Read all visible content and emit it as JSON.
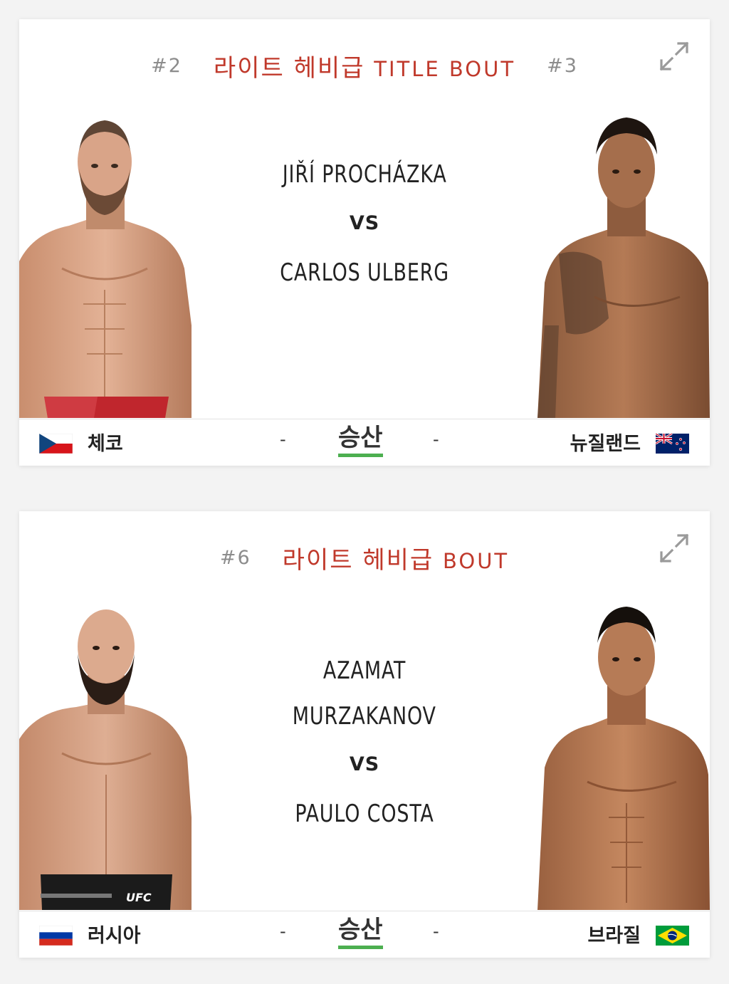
{
  "colors": {
    "title_red": "#c0392b",
    "rank_gray": "#8c8c8c",
    "result_underline": "#4caf50"
  },
  "bouts": [
    {
      "rank_left": "#2",
      "title_kr": "라이트 헤비급",
      "title_en": "TITLE BOUT",
      "rank_right": "#3",
      "fighter_red": "JIŘÍ PROCHÁZKA",
      "vs": "VS",
      "fighter_blue": "CARLOS ULBERG",
      "country_left": "체코",
      "country_right": "뉴질랜드",
      "flag_left": "czech-flag",
      "flag_right": "new-zealand-flag",
      "dash_left": "-",
      "dash_right": "-",
      "result": "승산",
      "expand_icon": "expand-icon"
    },
    {
      "rank_left": "#6",
      "title_kr": "라이트 헤비급",
      "title_en": "BOUT",
      "rank_right": "",
      "fighter_red_line1": "AZAMAT",
      "fighter_red_line2": "MURZAKANOV",
      "vs": "VS",
      "fighter_blue": "PAULO COSTA",
      "country_left": "러시아",
      "country_right": "브라질",
      "flag_left": "russia-flag",
      "flag_right": "brazil-flag",
      "dash_left": "-",
      "dash_right": "-",
      "result": "승산",
      "expand_icon": "expand-icon"
    }
  ]
}
